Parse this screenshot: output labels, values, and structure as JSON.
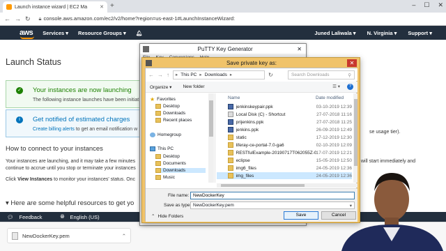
{
  "browser": {
    "tab_title": "Launch instance wizard | EC2 Ma",
    "url": "console.aws.amazon.com/ec2/v2/home?region=us-east-1#LaunchInstanceWizard:"
  },
  "aws_nav": {
    "logo": "aws",
    "services": "Services",
    "resource_groups": "Resource Groups",
    "user": "Juned Laliwala",
    "region": "N. Virginia",
    "support": "Support"
  },
  "page": {
    "title": "Launch Status",
    "panel_launch_title": "Your instances are now launching",
    "panel_launch_body": "The following instance launches have been initiat",
    "panel_billing_title": "Get notified of estimated charges",
    "panel_billing_link": "Create billing alerts",
    "panel_billing_body": " to get an email notification w",
    "right_fragment_usage": "se usage tier).",
    "howto_title": "How to connect to your instances",
    "howto_line1": "Your instances are launching, and it may take a few minutes",
    "howto_line2": "continue to accrue until you stop or terminate your instances",
    "howto_line3_pre": "Click ",
    "howto_line3_bold": "View Instances",
    "howto_line3_post": " to monitor your instances' status. Onc",
    "right_fragment_start": "will start immediately and",
    "resources_title": "Here are some helpful resources to get yo"
  },
  "footer": {
    "feedback": "Feedback",
    "language": "English (US)"
  },
  "download_bar": {
    "file": "NewDockerKey.pem"
  },
  "putty": {
    "title": "PuTTY Key Generator",
    "menu": [
      "File",
      "Key",
      "Conversions",
      "Help"
    ]
  },
  "save_dialog": {
    "title": "Save private key as:",
    "breadcrumb": [
      "This PC",
      "Downloads"
    ],
    "search_placeholder": "Search Downloads",
    "organize": "Organize",
    "new_folder": "New folder",
    "col_name": "Name",
    "col_date": "Date modified",
    "tree": {
      "favorites": "Favorites",
      "desktop": "Desktop",
      "downloads": "Downloads",
      "recent": "Recent places",
      "homegroup": "Homegroup",
      "this_pc": "This PC",
      "pc_desktop": "Desktop",
      "documents": "Documents",
      "pc_downloads": "Downloads",
      "music": "Music"
    },
    "files": [
      {
        "name": "jenkinskeypair.ppk",
        "date": "03-10-2019 12:39"
      },
      {
        "name": "Local Disk (C) - Shortcut",
        "date": "27-07-2018 11:16"
      },
      {
        "name": "prijenkins.ppk",
        "date": "27-07-2018 11:25"
      },
      {
        "name": "jenkins.ppk",
        "date": "26-09-2019 12:49"
      },
      {
        "name": "static",
        "date": "17-12-2019 12:30"
      },
      {
        "name": "liferay-ce-portal-7.0-ga6",
        "date": "02-10-2019 12:09"
      },
      {
        "name": "RESTfulExample-20190717T062055Z-001",
        "date": "17-07-2019 12:21"
      },
      {
        "name": "eclipse",
        "date": "15-05-2019 12:50"
      },
      {
        "name": "img6_files",
        "date": "24-05-2019 12:36"
      },
      {
        "name": "img_files",
        "date": "24-05-2019 12:36"
      }
    ],
    "file_name_label": "File name:",
    "file_name_value": "NewDockerKey",
    "save_as_type_label": "Save as type:",
    "save_as_type_value": "NewDockerKey.pem",
    "hide_folders": "Hide Folders",
    "save": "Save",
    "cancel": "Cancel"
  }
}
